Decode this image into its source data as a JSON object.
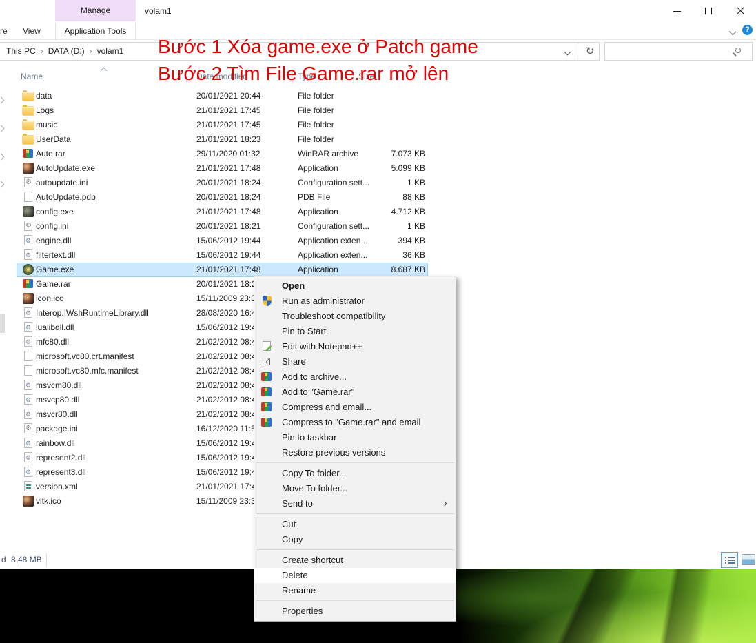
{
  "window": {
    "title": "volam1",
    "manage_tab": "Manage",
    "app_tools_tab": "Application Tools"
  },
  "ribbon": {
    "share_tab_fragment": "re",
    "view_tab": "View"
  },
  "breadcrumb": {
    "item1": "This PC",
    "item2": "DATA (D:)",
    "item3": "volam1",
    "separator": "›"
  },
  "search": {
    "value": ""
  },
  "annotation": {
    "line1": "Bước 1 Xóa game.exe ở Patch game",
    "line2": "Bước 2 Tìm File Game.rar mở lên"
  },
  "columns": {
    "name": "Name",
    "date_modified": "Date modified",
    "type": "Type",
    "size": "Size"
  },
  "files": [
    {
      "name": "data",
      "date": "20/01/2021 20:44",
      "type": "File folder",
      "size": "",
      "icon": "folder"
    },
    {
      "name": "Logs",
      "date": "21/01/2021 17:45",
      "type": "File folder",
      "size": "",
      "icon": "folder"
    },
    {
      "name": "music",
      "date": "21/01/2021 17:45",
      "type": "File folder",
      "size": "",
      "icon": "folder"
    },
    {
      "name": "UserData",
      "date": "21/01/2021 18:23",
      "type": "File folder",
      "size": "",
      "icon": "folder"
    },
    {
      "name": "Auto.rar",
      "date": "29/11/2020 01:32",
      "type": "WinRAR archive",
      "size": "7.073 KB",
      "icon": "winrar"
    },
    {
      "name": "AutoUpdate.exe",
      "date": "21/01/2021 17:48",
      "type": "Application",
      "size": "5.099 KB",
      "icon": "appart"
    },
    {
      "name": "autoupdate.ini",
      "date": "20/01/2021 18:24",
      "type": "Configuration sett...",
      "size": "1 KB",
      "icon": "ini"
    },
    {
      "name": "AutoUpdate.pdb",
      "date": "20/01/2021 18:24",
      "type": "PDB File",
      "size": "88 KB",
      "icon": "page"
    },
    {
      "name": "config.exe",
      "date": "21/01/2021 17:48",
      "type": "Application",
      "size": "4.712 KB",
      "icon": "appdark"
    },
    {
      "name": "config.ini",
      "date": "20/01/2021 18:21",
      "type": "Configuration sett...",
      "size": "1 KB",
      "icon": "ini"
    },
    {
      "name": "engine.dll",
      "date": "15/06/2012 19:44",
      "type": "Application exten...",
      "size": "394 KB",
      "icon": "dll"
    },
    {
      "name": "filtertext.dll",
      "date": "15/06/2012 19:44",
      "type": "Application exten...",
      "size": "36 KB",
      "icon": "dll"
    },
    {
      "name": "Game.exe",
      "date": "21/01/2021 17:48",
      "type": "Application",
      "size": "8.687 KB",
      "icon": "gameexe",
      "cls": "selected"
    },
    {
      "name": "Game.rar",
      "date": "20/01/2021 18:2",
      "type": "",
      "size": "",
      "icon": "winrar"
    },
    {
      "name": "icon.ico",
      "date": "15/11/2009 23:3",
      "type": "",
      "size": "",
      "icon": "appart"
    },
    {
      "name": "Interop.IWshRuntimeLibrary.dll",
      "date": "28/08/2020 16:4",
      "type": "",
      "size": "",
      "icon": "dll"
    },
    {
      "name": "lualibdll.dll",
      "date": "15/06/2012 19:4",
      "type": "",
      "size": "",
      "icon": "dll"
    },
    {
      "name": "mfc80.dll",
      "date": "21/02/2012 08:4",
      "type": "",
      "size": "",
      "icon": "dll"
    },
    {
      "name": "microsoft.vc80.crt.manifest",
      "date": "21/02/2012 08:4",
      "type": "",
      "size": "",
      "icon": "page"
    },
    {
      "name": "microsoft.vc80.mfc.manifest",
      "date": "21/02/2012 08:4",
      "type": "",
      "size": "",
      "icon": "page"
    },
    {
      "name": "msvcm80.dll",
      "date": "21/02/2012 08:4",
      "type": "",
      "size": "",
      "icon": "dll"
    },
    {
      "name": "msvcp80.dll",
      "date": "21/02/2012 08:4",
      "type": "",
      "size": "",
      "icon": "dll"
    },
    {
      "name": "msvcr80.dll",
      "date": "21/02/2012 08:4",
      "type": "",
      "size": "",
      "icon": "dll"
    },
    {
      "name": "package.ini",
      "date": "16/12/2020 11:5",
      "type": "",
      "size": "",
      "icon": "ini"
    },
    {
      "name": "rainbow.dll",
      "date": "15/06/2012 19:4",
      "type": "",
      "size": "",
      "icon": "dll"
    },
    {
      "name": "represent2.dll",
      "date": "15/06/2012 19:4",
      "type": "",
      "size": "",
      "icon": "dll"
    },
    {
      "name": "represent3.dll",
      "date": "15/06/2012 19:4",
      "type": "",
      "size": "",
      "icon": "dll"
    },
    {
      "name": "version.xml",
      "date": "21/01/2021 17:4",
      "type": "",
      "size": "",
      "icon": "xml"
    },
    {
      "name": "vltk.ico",
      "date": "15/11/2009 23:3",
      "type": "",
      "size": "",
      "icon": "appart"
    }
  ],
  "context_menu": [
    {
      "label": "Open",
      "cls": "default"
    },
    {
      "label": "Run as administrator",
      "icon": "shield"
    },
    {
      "label": "Troubleshoot compatibility"
    },
    {
      "label": "Pin to Start"
    },
    {
      "label": "Edit with Notepad++",
      "icon": "npp"
    },
    {
      "label": "Share",
      "icon": "share"
    },
    {
      "label": "Add to archive...",
      "icon": "winrar"
    },
    {
      "label": "Add to \"Game.rar\"",
      "icon": "winrar"
    },
    {
      "label": "Compress and email...",
      "icon": "winrar"
    },
    {
      "label": "Compress to \"Game.rar\" and email",
      "icon": "winrar"
    },
    {
      "label": "Pin to taskbar"
    },
    {
      "label": "Restore previous versions"
    },
    {
      "cls": "sep"
    },
    {
      "label": "Copy To folder..."
    },
    {
      "label": "Move To folder..."
    },
    {
      "label": "Send to",
      "arrow": "›"
    },
    {
      "cls": "sep"
    },
    {
      "label": "Cut"
    },
    {
      "label": "Copy"
    },
    {
      "cls": "sep"
    },
    {
      "label": "Create shortcut"
    },
    {
      "label": "Delete",
      "cls": "hover"
    },
    {
      "label": "Rename"
    },
    {
      "cls": "sep"
    },
    {
      "label": "Properties"
    }
  ],
  "status_bar": {
    "selected_fragment": "d",
    "size": "8,48 MB"
  },
  "colors": {
    "selection_bg": "#cce8ff",
    "selection_border": "#99d1ff",
    "annotation_red": "#e30000",
    "manage_tab_bg": "#f0ddf7",
    "menu_bg": "#f2f2f2",
    "menu_hover": "#ffffff",
    "header_text": "#6d7a8f",
    "wallpaper_green": "#7cc62a"
  }
}
